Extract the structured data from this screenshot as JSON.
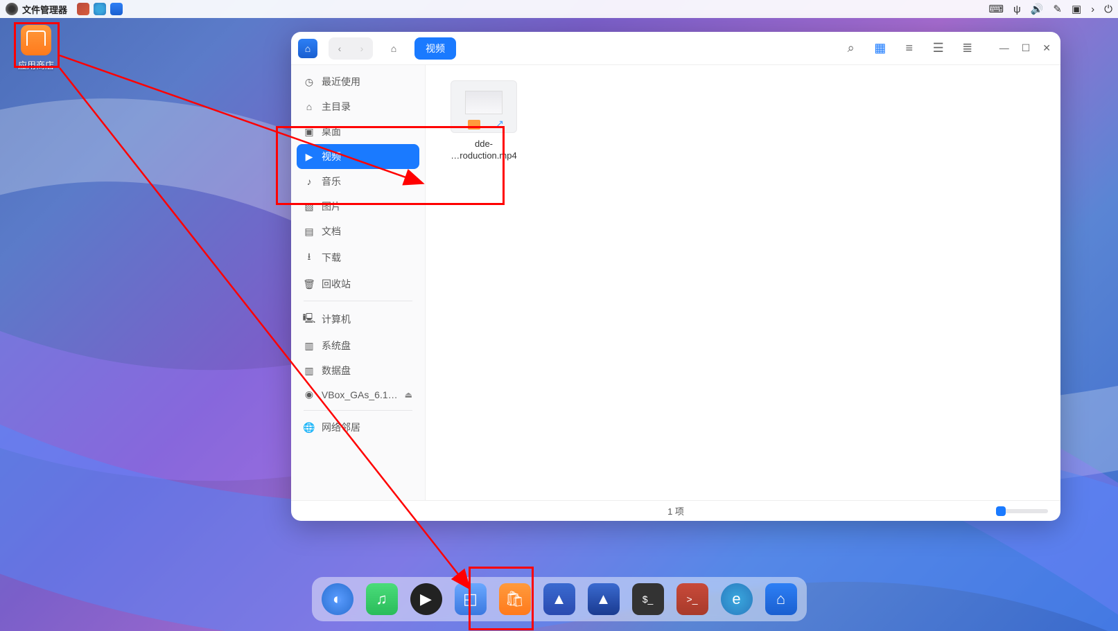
{
  "menubar": {
    "app_name": "文件管理器",
    "tray_icons": [
      "keyboard-icon",
      "usb-icon",
      "volume-icon",
      "brush-icon",
      "battery-icon",
      "chevron-right-icon",
      "power-icon"
    ]
  },
  "desktop": {
    "appstore_label": "应用商店"
  },
  "window": {
    "path_current": "视频",
    "sidebar": {
      "items": [
        {
          "icon": "clock-icon",
          "label": "最近使用",
          "active": false
        },
        {
          "icon": "home-icon",
          "label": "主目录",
          "active": false
        },
        {
          "icon": "desktop-icon",
          "label": "桌面",
          "active": false
        },
        {
          "icon": "video-icon",
          "label": "视频",
          "active": true
        },
        {
          "icon": "music-icon",
          "label": "音乐",
          "active": false
        },
        {
          "icon": "image-icon",
          "label": "图片",
          "active": false
        },
        {
          "icon": "document-icon",
          "label": "文档",
          "active": false
        },
        {
          "icon": "download-icon",
          "label": "下载",
          "active": false
        },
        {
          "icon": "trash-icon",
          "label": "回收站",
          "active": false
        }
      ],
      "devices": [
        {
          "icon": "computer-icon",
          "label": "计算机"
        },
        {
          "icon": "disk-icon",
          "label": "系统盘"
        },
        {
          "icon": "disk-icon",
          "label": "数据盘"
        },
        {
          "icon": "disc-icon",
          "label": "VBox_GAs_6.1…",
          "eject": true
        }
      ],
      "network": [
        {
          "icon": "globe-icon",
          "label": "网络邻居"
        }
      ]
    },
    "files": [
      {
        "name_line1": "dde-",
        "name_line2": "…roduction.mp4"
      }
    ],
    "status": "1 项"
  },
  "dock": {
    "items": [
      {
        "name": "launcher",
        "glyph": "◐"
      },
      {
        "name": "music",
        "glyph": "♫"
      },
      {
        "name": "video-player",
        "glyph": "▶"
      },
      {
        "name": "screenshot",
        "glyph": "✂"
      },
      {
        "name": "app-store",
        "glyph": "🛍"
      },
      {
        "name": "mail",
        "glyph": "✉"
      },
      {
        "name": "mail-client",
        "glyph": "✉"
      },
      {
        "name": "terminal",
        "glyph": "$_"
      },
      {
        "name": "terminal-root",
        "glyph": ">_"
      },
      {
        "name": "edge-browser",
        "glyph": "e"
      },
      {
        "name": "file-manager",
        "glyph": "📁"
      }
    ]
  }
}
